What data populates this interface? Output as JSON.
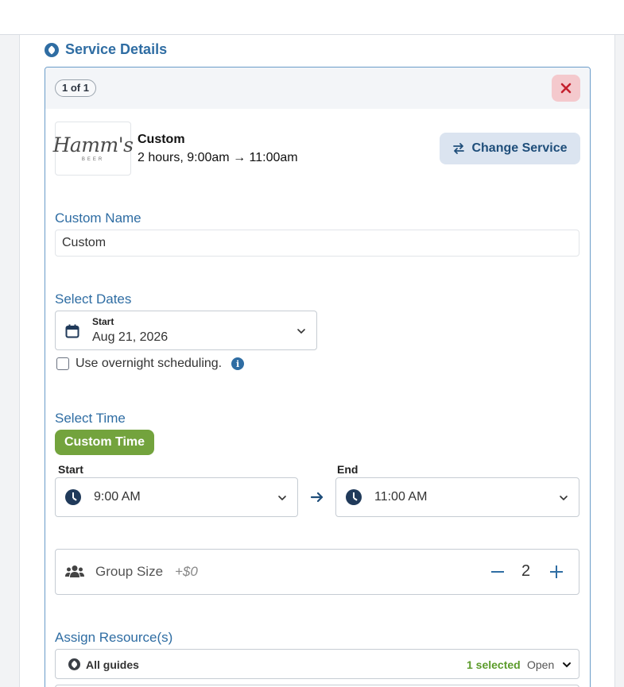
{
  "section": {
    "title": "Service Details",
    "icon": "compass-icon"
  },
  "card": {
    "counter": "1 of 1",
    "close_icon": "close-icon",
    "service": {
      "logo_text": "Hamm's",
      "logo_sub": "BEER",
      "name": "Custom",
      "duration": "2 hours, 9:00am → 11:00am"
    },
    "change_service_label": "Change Service"
  },
  "custom_name": {
    "label": "Custom Name",
    "value": "Custom"
  },
  "dates": {
    "label": "Select Dates",
    "start_label": "Start",
    "start_value": "Aug 21, 2026",
    "overnight_label": "Use overnight scheduling.",
    "overnight_checked": false
  },
  "time": {
    "label": "Select Time",
    "custom_time_label": "Custom Time",
    "start_label": "Start",
    "start_value": "9:00 AM",
    "end_label": "End",
    "end_value": "11:00 AM"
  },
  "group": {
    "label": "Group Size",
    "price": "+$0",
    "count": "2"
  },
  "resources": {
    "label": "Assign Resource(s)",
    "row_name": "All guides",
    "selected_text": "1 selected",
    "open_text": "Open"
  },
  "colors": {
    "accent": "#2f6da3",
    "green": "#73a33d",
    "close_bg": "#f4c9cd",
    "close_x": "#c4202e"
  }
}
